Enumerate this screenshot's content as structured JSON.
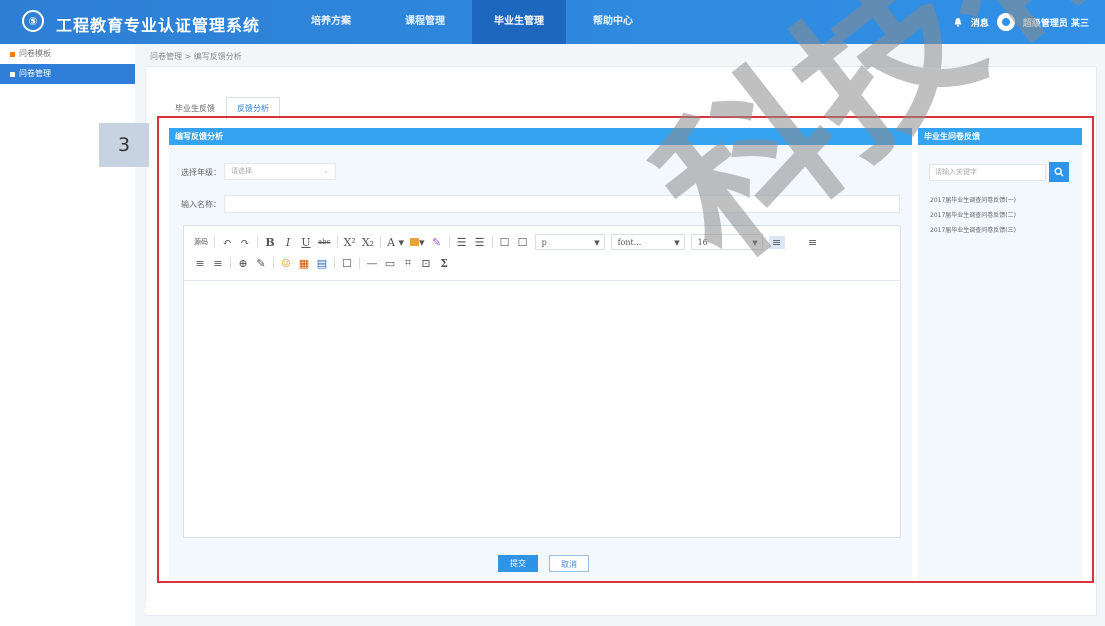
{
  "app": {
    "title": "工程教育专业认证管理系统",
    "logo_char": "⑤"
  },
  "nav": {
    "items": [
      {
        "label": "培养方案"
      },
      {
        "label": "课程管理"
      },
      {
        "label": "毕业生管理"
      },
      {
        "label": "帮助中心"
      }
    ],
    "active_index": 2
  },
  "header_right": {
    "messages_label": "消息",
    "user_label": "超级管理员 某三"
  },
  "sidebar": {
    "items": [
      {
        "label": "问卷模板"
      },
      {
        "label": "问卷管理"
      }
    ],
    "active_index": 1
  },
  "breadcrumb": {
    "text": "问卷管理 > 编写反馈分析"
  },
  "tabs": {
    "items": [
      {
        "label": "毕业生反馈"
      },
      {
        "label": "反馈分析"
      }
    ],
    "active_index": 1
  },
  "annotation": {
    "step": "3"
  },
  "form": {
    "panel_title": "编写反馈分析",
    "year_label": "选择年级：",
    "year_placeholder": "请选择",
    "name_label": "输入名称：",
    "name_value": ""
  },
  "editor": {
    "toolbar_row1": [
      "源码",
      "↶",
      "↷",
      "B",
      "I",
      "U",
      "abc",
      "X²",
      "X₂",
      "A ▾",
      "▾",
      "✎",
      "☰",
      "☰",
      "☐",
      "☐"
    ],
    "paragraph_select": "p",
    "font_select": "font...",
    "size_select": "16",
    "toolbar_row2": [
      "≡",
      "≡",
      "⊕",
      "✎",
      "☺",
      "▦",
      "▤",
      "☐",
      "—",
      "▭",
      "⌗",
      "⊡",
      "Σ"
    ],
    "content": ""
  },
  "buttons": {
    "submit": "提交",
    "cancel": "取消"
  },
  "right_panel": {
    "title": "毕业生问卷反馈",
    "search_placeholder": "请输入关键字",
    "items": [
      {
        "label": "2017届毕业生调查问卷反馈(一)"
      },
      {
        "label": "2017届毕业生调查问卷反馈(二)"
      },
      {
        "label": "2017届毕业生调查问卷反馈(三)"
      }
    ]
  },
  "watermark": {
    "text": "科技有限"
  },
  "colors": {
    "primary": "#2f94e8",
    "nav_bg": "#3191e6",
    "annotation_border": "#d9343c"
  }
}
